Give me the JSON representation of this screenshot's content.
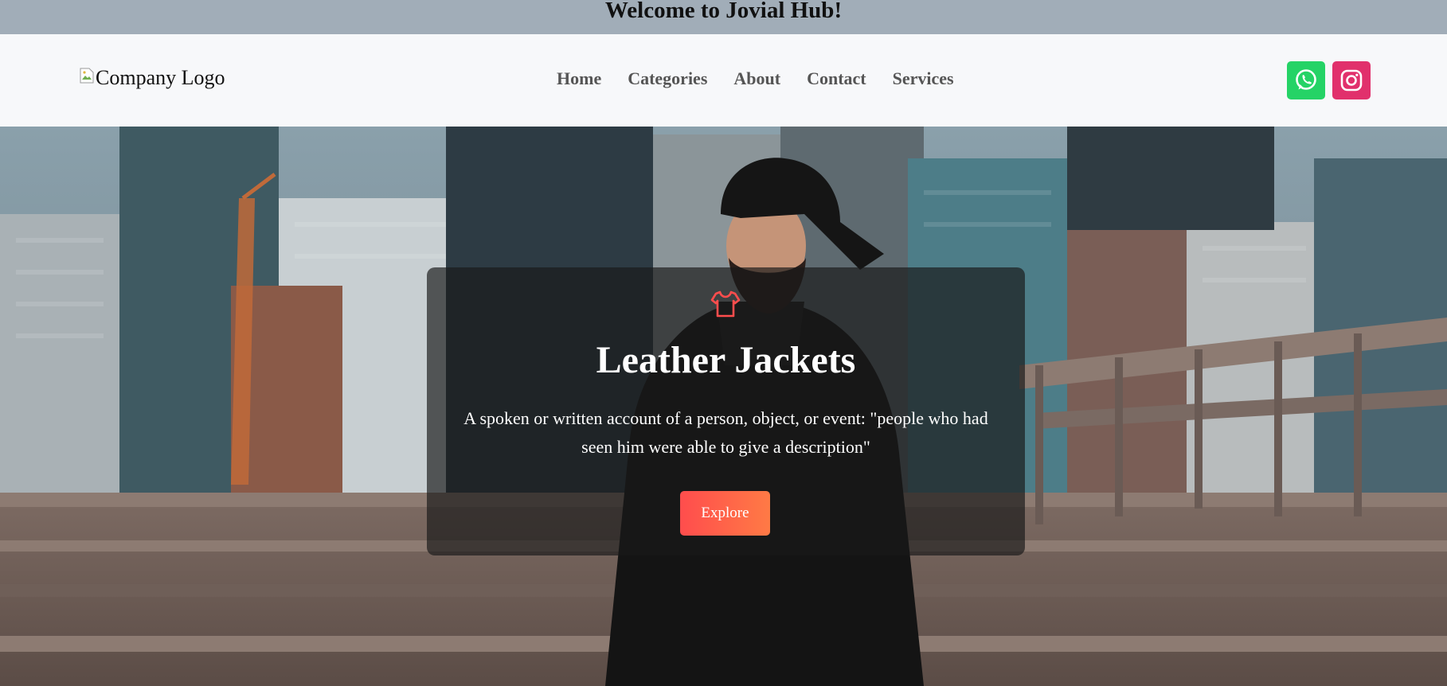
{
  "banner": {
    "title": "Welcome to Jovial Hub!"
  },
  "header": {
    "logo_alt": "Company Logo",
    "nav": [
      {
        "label": "Home"
      },
      {
        "label": "Categories"
      },
      {
        "label": "About"
      },
      {
        "label": "Contact"
      },
      {
        "label": "Services"
      }
    ],
    "social": [
      {
        "name": "whatsapp-icon",
        "color": "#25d366"
      },
      {
        "name": "instagram-icon",
        "color": "#e1306c"
      }
    ]
  },
  "hero": {
    "icon": "shirt-icon",
    "icon_color": "#ff4d4d",
    "title": "Leather Jackets",
    "description": "A spoken or written account of a person, object, or event: \"people who had seen him were able to give a description\"",
    "cta_label": "Explore",
    "cta_gradient": [
      "#ff4d4d",
      "#ff7a45"
    ]
  }
}
